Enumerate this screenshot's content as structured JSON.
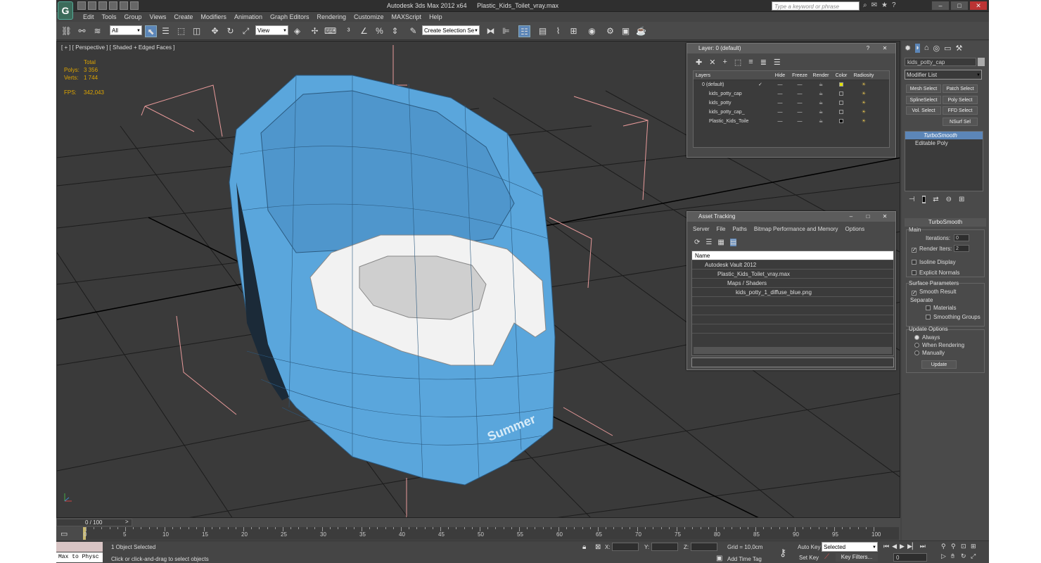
{
  "window": {
    "title_app": "Autodesk 3ds Max  2012 x64",
    "title_file": "Plastic_Kids_Toilet_vray.max",
    "search_placeholder": "Type a keyword or phrase"
  },
  "menu": [
    "Edit",
    "Tools",
    "Group",
    "Views",
    "Create",
    "Modifiers",
    "Animation",
    "Graph Editors",
    "Rendering",
    "Customize",
    "MAXScript",
    "Help"
  ],
  "toolbar": {
    "filter_value": "All",
    "refcoord_value": "View",
    "selection_set_placeholder": "Create Selection Se"
  },
  "viewport": {
    "label": "[ + ] [ Perspective ] [ Shaded + Edged Faces ]",
    "stats": {
      "total_label": "Total",
      "polys_label": "Polys:",
      "polys_value": "3 356",
      "verts_label": "Verts:",
      "verts_value": "1 744",
      "fps_label": "FPS:",
      "fps_value": "342,043"
    },
    "model_text": "Summer"
  },
  "layer_panel": {
    "title": "Layer: 0 (default)",
    "columns": [
      "Layers",
      "Hide",
      "Freeze",
      "Render",
      "Color",
      "Radiosity"
    ],
    "rows": [
      {
        "name": "0 (default)",
        "check": "✓",
        "color": "#e0e000"
      },
      {
        "name": "kids_potty_cap",
        "check": "",
        "color": "#3a3a3a"
      },
      {
        "name": "kids_potty",
        "check": "",
        "color": "#3a3a3a"
      },
      {
        "name": "kids_potty_cap_",
        "check": "",
        "color": "#3a3a3a"
      },
      {
        "name": "Plastic_Kids_Toile",
        "check": "",
        "color": "#000000"
      }
    ]
  },
  "asset_panel": {
    "title": "Asset Tracking",
    "menu": [
      "Server",
      "File",
      "Paths",
      "Bitmap Performance and Memory",
      "Options"
    ],
    "column": "Name",
    "rows": [
      "Autodesk Vault 2012",
      "Plastic_Kids_Toilet_vray.max",
      "Maps / Shaders",
      "kids_potty_1_diffuse_blue.png"
    ]
  },
  "command_panel": {
    "object_name": "kids_potty_cap",
    "modifier_list": "Modifier List",
    "buttons": [
      "Mesh Select",
      "Patch Select",
      "SplineSelect",
      "Poly Select",
      "Vol. Select",
      "FFD Select",
      "NSurf Sel"
    ],
    "stack": [
      "TurboSmooth",
      "Editable Poly"
    ],
    "rollout_title": "TurboSmooth",
    "main_label": "Main",
    "iterations_label": "Iterations:",
    "iterations_value": "0",
    "render_iters_label": "Render Iters:",
    "render_iters_value": "2",
    "isoline_label": "Isoline Display",
    "explicit_label": "Explicit Normals",
    "surface_label": "Surface Parameters",
    "smooth_result_label": "Smooth Result",
    "separate_label": "Separate",
    "materials_label": "Materials",
    "smoothing_groups_label": "Smoothing Groups",
    "update_options_label": "Update Options",
    "always_label": "Always",
    "when_rendering_label": "When Rendering",
    "manually_label": "Manually",
    "update_button": "Update"
  },
  "timeline": {
    "frame_label": "0 / 100",
    "ticks": [
      "0",
      "5",
      "10",
      "15",
      "20",
      "25",
      "30",
      "35",
      "40",
      "45",
      "50",
      "55",
      "60",
      "65",
      "70",
      "75",
      "80",
      "85",
      "90",
      "95",
      "100"
    ]
  },
  "status": {
    "script_label": "Max to Physc",
    "selected_text": "1 Object Selected",
    "prompt_text": "Click or click-and-drag to select objects",
    "x_label": "X:",
    "y_label": "Y:",
    "z_label": "Z:",
    "grid_text": "Grid = 10,0cm",
    "add_time_tag": "Add Time Tag",
    "auto_key": "Auto Key",
    "set_key": "Set Key",
    "selected_value": "Selected",
    "key_filters": "Key Filters...",
    "frame_value": "0"
  }
}
